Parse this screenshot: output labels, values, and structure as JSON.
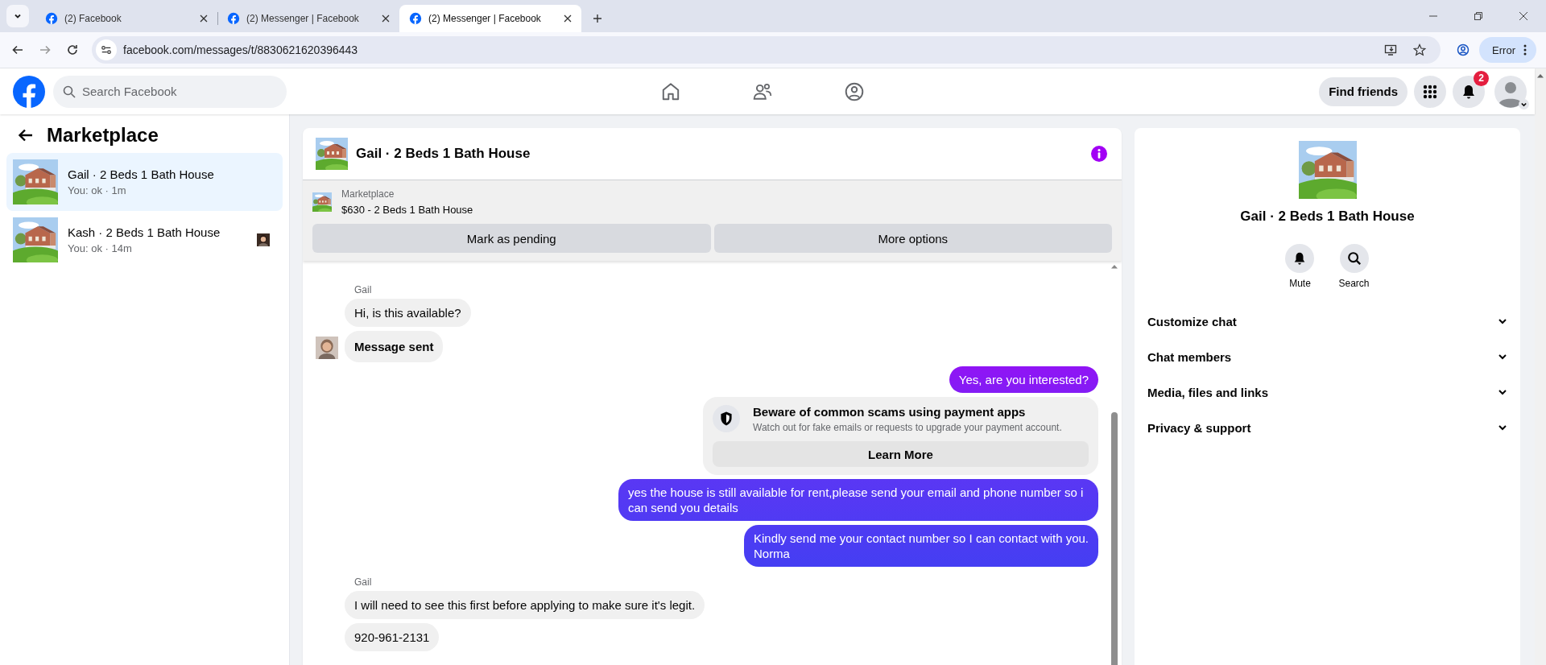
{
  "browser": {
    "tabs": [
      {
        "title": "(2) Facebook",
        "selected": false
      },
      {
        "title": "(2) Messenger | Facebook",
        "selected": false
      },
      {
        "title": "(2) Messenger | Facebook",
        "selected": true
      }
    ],
    "url": "facebook.com/messages/t/8830621620396443",
    "profile_button": "Error"
  },
  "header": {
    "search": {
      "placeholder": "Search Facebook"
    },
    "find_friends": "Find friends",
    "notification_count": "2"
  },
  "sidebar": {
    "title": "Marketplace",
    "conversations": [
      {
        "name": "Gail · 2 Beds 1 Bath House",
        "preview": "You: ok · 1m",
        "selected": true,
        "seen_avatar": false
      },
      {
        "name": "Kash · 2 Beds 1 Bath House",
        "preview": "You: ok · 14m",
        "selected": false,
        "seen_avatar": true
      }
    ]
  },
  "chat": {
    "title": "Gail · 2 Beds 1 Bath House",
    "listing": {
      "label": "Marketplace",
      "title": "$630 - 2 Beds 1 Bath House"
    },
    "actions": [
      "Mark as pending",
      "More options"
    ],
    "messages": [
      {
        "kind": "sender",
        "text": "Gail"
      },
      {
        "kind": "in",
        "text": "Hi, is this available?",
        "bold": false,
        "avatar": false
      },
      {
        "kind": "in",
        "text": "Message sent",
        "bold": true,
        "avatar": true
      },
      {
        "kind": "out",
        "text": "Yes, are you interested?"
      },
      {
        "kind": "notice",
        "title": "Beware of common scams using payment apps",
        "body": "Watch out for fake emails or requests to upgrade your payment account.",
        "button": "Learn More"
      },
      {
        "kind": "out",
        "text": "yes the house is still available for rent,please send your email and phone number so i can send you details"
      },
      {
        "kind": "out",
        "text": "Kindly send me your contact number so I can contact with you.\nNorma"
      },
      {
        "kind": "sender",
        "text": "Gail"
      },
      {
        "kind": "in",
        "text": "I will need to see this first before applying to make sure it's legit.",
        "bold": false,
        "avatar": false
      },
      {
        "kind": "in",
        "text": "920-961-2131",
        "bold": false,
        "avatar": false
      }
    ]
  },
  "details": {
    "name": "Gail · 2 Beds 1 Bath House",
    "actions": [
      {
        "kind": "mute",
        "label": "Mute"
      },
      {
        "kind": "search",
        "label": "Search"
      }
    ],
    "sections": [
      {
        "label": "Customize chat",
        "expanded": false
      },
      {
        "label": "Chat members",
        "expanded": false
      },
      {
        "label": "Media, files and links",
        "expanded": false
      },
      {
        "label": "Privacy & support",
        "expanded": false
      }
    ]
  }
}
